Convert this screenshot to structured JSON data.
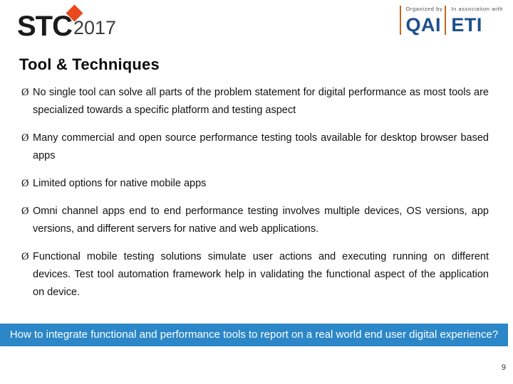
{
  "header": {
    "logo": {
      "brand": "STC",
      "year": "2017",
      "diamond_color": "#e8491d"
    },
    "partners": [
      {
        "label": "Organized by",
        "name": "QAI"
      },
      {
        "label": "In association with",
        "name": "ETI"
      }
    ]
  },
  "slide": {
    "title": "Tool & Techniques",
    "bullet_marker": "Ø",
    "bullets": [
      "No single tool can solve all parts of the problem statement for digital performance as most tools are specialized towards a specific platform and testing aspect",
      "Many commercial and open source performance testing tools available for desktop browser based apps",
      "Limited options for native mobile apps",
      "Omni channel apps end to end performance testing involves multiple devices, OS versions, app versions, and different servers for native and web applications.",
      "Functional mobile testing solutions simulate user actions and executing running on different devices. Test tool automation framework help in validating the functional aspect of the application on device."
    ],
    "banner_text": "How to integrate functional and performance tools to report on a real world end user digital experience?",
    "banner_color": "#2b87c7",
    "page_number": "9"
  }
}
